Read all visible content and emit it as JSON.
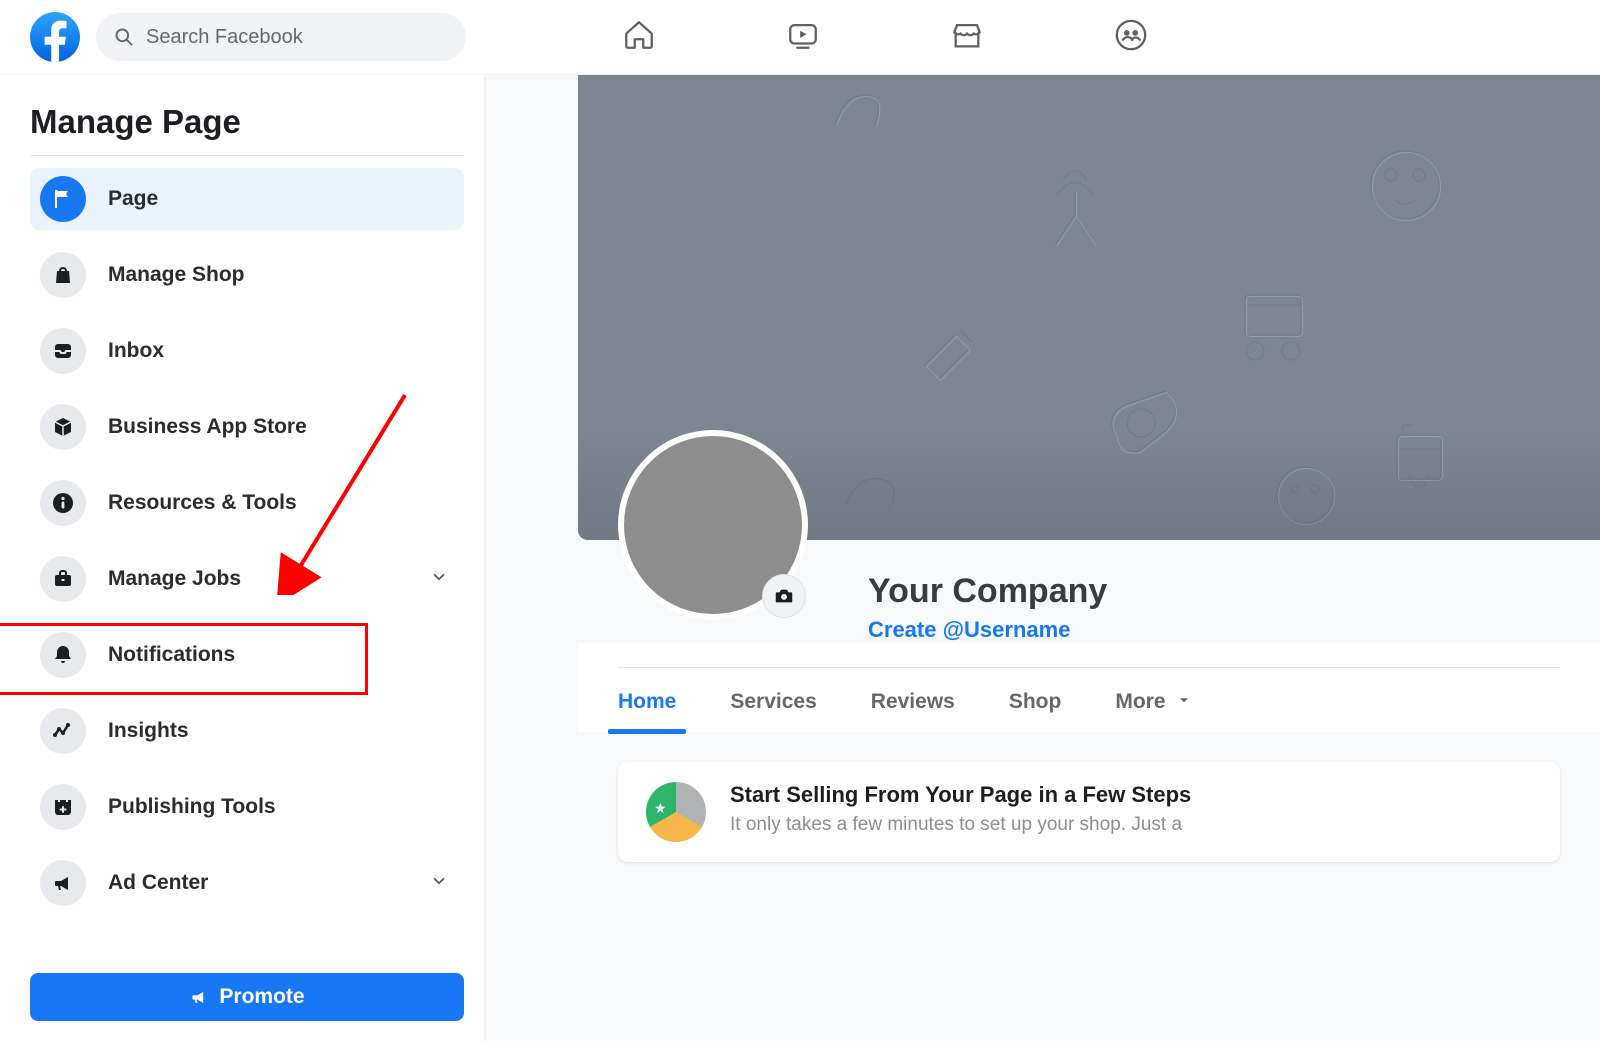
{
  "search": {
    "placeholder": "Search Facebook"
  },
  "sidebar": {
    "title": "Manage Page",
    "items": [
      {
        "label": "Page",
        "icon": "flag-icon",
        "active": true
      },
      {
        "label": "Manage Shop",
        "icon": "bag-icon"
      },
      {
        "label": "Inbox",
        "icon": "tray-icon"
      },
      {
        "label": "Business App Store",
        "icon": "cube-icon"
      },
      {
        "label": "Resources & Tools",
        "icon": "info-icon"
      },
      {
        "label": "Manage Jobs",
        "icon": "briefcase-icon",
        "expandable": true
      },
      {
        "label": "Notifications",
        "icon": "bell-icon"
      },
      {
        "label": "Insights",
        "icon": "activity-icon",
        "highlighted": true
      },
      {
        "label": "Publishing Tools",
        "icon": "calendar-plus-icon"
      },
      {
        "label": "Ad Center",
        "icon": "bullhorn-icon",
        "expandable": true
      }
    ],
    "promote_label": "Promote"
  },
  "top_nav": {
    "items": [
      "home-icon",
      "watch-icon",
      "marketplace-icon",
      "groups-icon"
    ]
  },
  "page_profile": {
    "name": "Your Company",
    "username_cta": "Create @Username"
  },
  "tabs": {
    "items": [
      {
        "label": "Home",
        "active": true
      },
      {
        "label": "Services"
      },
      {
        "label": "Reviews"
      },
      {
        "label": "Shop"
      },
      {
        "label": "More",
        "has_more": true
      }
    ]
  },
  "promo_card": {
    "title": "Start Selling From Your Page in a Few Steps",
    "subtitle": "It only takes a few minutes to set up your shop. Just a"
  },
  "colors": {
    "brand": "#1877F2",
    "annotation": "#FF0000",
    "cover": "#7E8490"
  }
}
